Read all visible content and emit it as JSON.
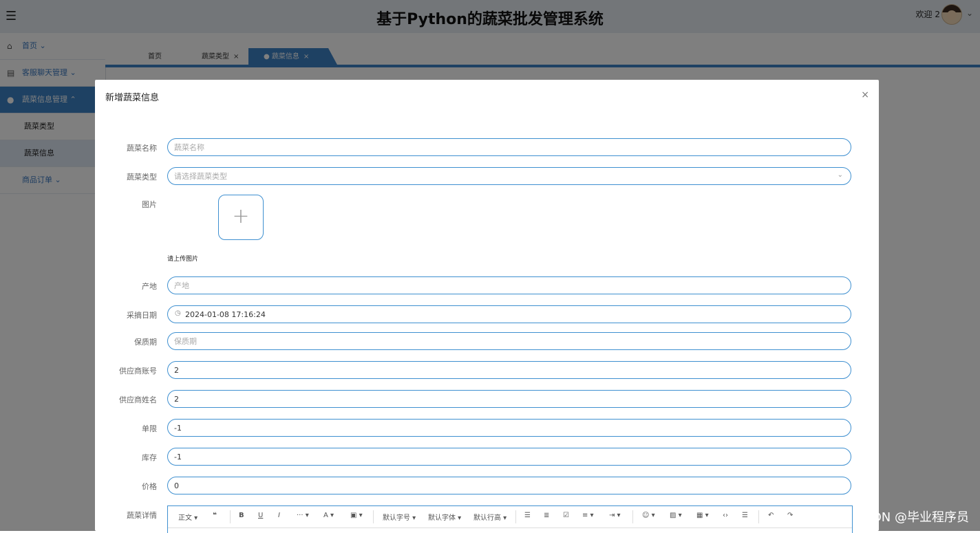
{
  "app": {
    "title": "基于Python的蔬菜批发管理系统",
    "welcome": "欢迎 2",
    "menu_icon": "hamburger-icon",
    "caret": "⌄"
  },
  "sidebar": {
    "items": [
      {
        "label": "首页",
        "icon": "home-icon"
      },
      {
        "label": "客服聊天管理",
        "icon": "chart-icon"
      },
      {
        "label": "蔬菜信息管理",
        "icon": "circle-icon"
      },
      {
        "label": "商品订单",
        "icon": ""
      }
    ],
    "subitems": [
      "蔬菜类型",
      "蔬菜信息"
    ]
  },
  "tabs": [
    {
      "label": "首页"
    },
    {
      "label": "蔬菜类型",
      "close": "×"
    },
    {
      "label": "● 蔬菜信息",
      "close": "×"
    }
  ],
  "modal": {
    "title": "新增蔬菜信息",
    "close": "×",
    "fields": {
      "name": {
        "label": "蔬菜名称",
        "placeholder": "蔬菜名称",
        "value": ""
      },
      "type": {
        "label": "蔬菜类型",
        "placeholder": "请选择蔬菜类型",
        "value": ""
      },
      "image": {
        "label": "图片",
        "hint": "请上传图片",
        "plus": "+"
      },
      "origin": {
        "label": "产地",
        "placeholder": "产地",
        "value": ""
      },
      "pick_date": {
        "label": "采摘日期",
        "value": "2024-01-08 17:16:24"
      },
      "shelf_life": {
        "label": "保质期",
        "placeholder": "保质期",
        "value": ""
      },
      "supplier_account": {
        "label": "供应商账号",
        "value": "2"
      },
      "supplier_name": {
        "label": "供应商姓名",
        "value": "2"
      },
      "limit": {
        "label": "单限",
        "value": "-1"
      },
      "stock": {
        "label": "库存",
        "value": "-1"
      },
      "price": {
        "label": "价格",
        "value": "0"
      },
      "detail": {
        "label": "蔬菜详情"
      }
    },
    "toolbar": {
      "paragraph": "正文",
      "font_size": "默认字号",
      "font_family": "默认字体",
      "line_height": "默认行高"
    }
  },
  "watermark": "CSDN @毕业程序员",
  "colors": {
    "accent": "#3d83c7",
    "topbar": "#e7edf3"
  }
}
